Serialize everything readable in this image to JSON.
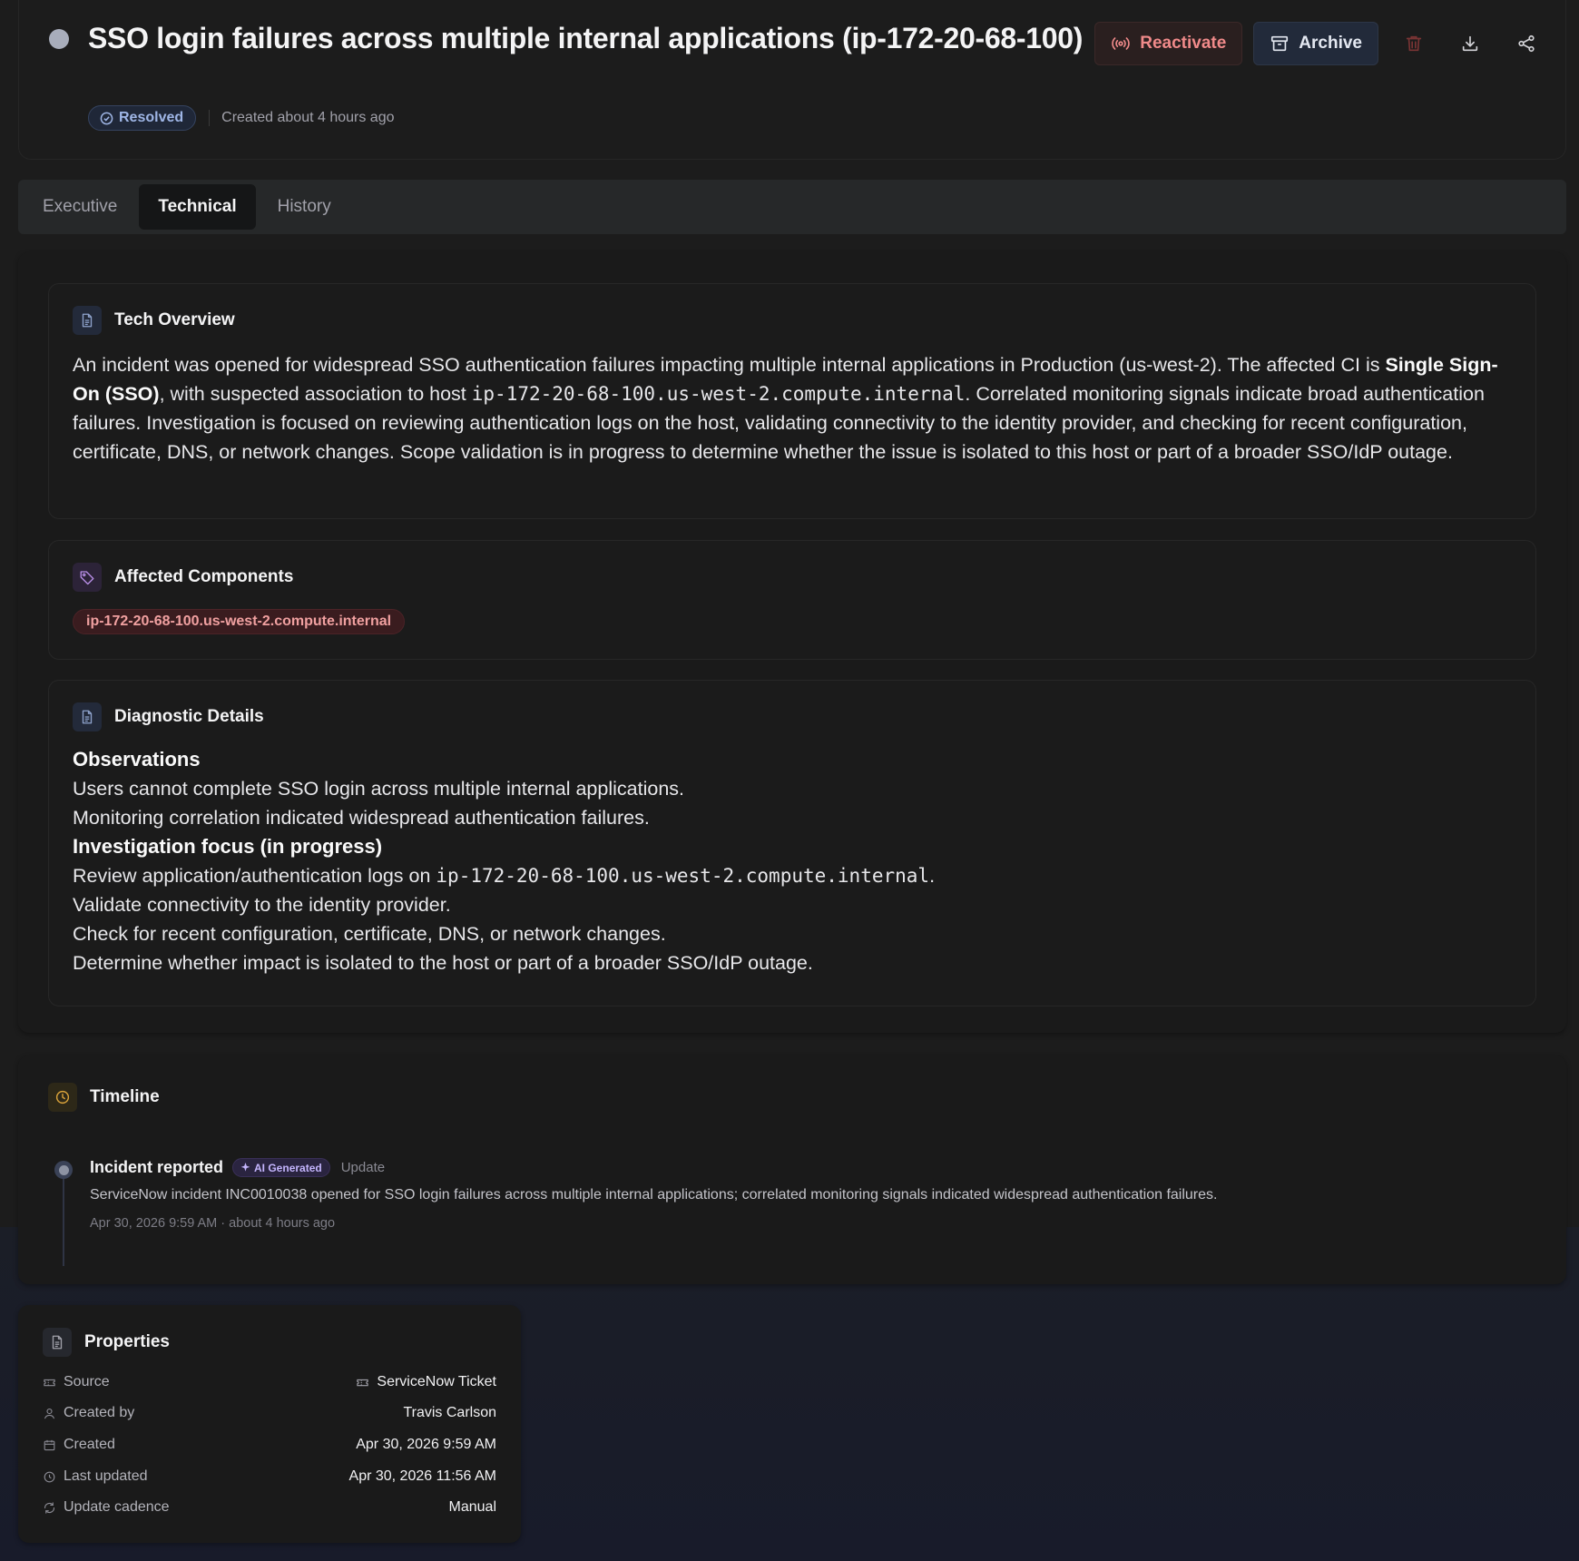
{
  "incident": {
    "title": "SSO login failures across multiple internal applications (ip-172-20-68-100)",
    "status": "Resolved",
    "created_relative": "Created about 4 hours ago"
  },
  "actions": {
    "reactivate_label": "Reactivate",
    "archive_label": "Archive",
    "delete_icon": "trash-icon",
    "download_icon": "download-icon",
    "share_icon": "share-icon"
  },
  "tabs": [
    {
      "label": "Executive",
      "active": false
    },
    {
      "label": "Technical",
      "active": true
    },
    {
      "label": "History",
      "active": false
    }
  ],
  "tech_overview": {
    "title": "Tech Overview",
    "p1": "An incident was opened for widespread SSO authentication failures impacting multiple internal applications in Production (us-west-2). The affected CI is ",
    "ci": "Single Sign-On (SSO)",
    "p2": ", with suspected association to host ",
    "host": "ip-172-20-68-100.us-west-2.compute.internal",
    "p3": ". Correlated monitoring signals indicate broad authentication failures. Investigation is focused on reviewing authentication logs on the host, validating connectivity to the identity provider, and checking for recent configuration, certificate, DNS, or network changes. Scope validation is in progress to determine whether the issue is isolated to this host or part of a broader SSO/IdP outage."
  },
  "affected_components": {
    "title": "Affected Components",
    "items": [
      "ip-172-20-68-100.us-west-2.compute.internal"
    ]
  },
  "diagnostic_details": {
    "title": "Diagnostic Details",
    "observations_heading": "Observations",
    "obs1": "Users cannot complete SSO login across multiple internal applications.",
    "obs2": "Monitoring correlation indicated widespread authentication failures.",
    "investigation_heading": "Investigation focus (in progress)",
    "inv1_a": "Review application/authentication logs on ",
    "inv1_host": "ip-172-20-68-100.us-west-2.compute.internal",
    "inv1_b": ".",
    "inv2": "Validate connectivity to the identity provider.",
    "inv3": "Check for recent configuration, certificate, DNS, or network changes.",
    "inv4": "Determine whether impact is isolated to the host or part of a broader SSO/IdP outage."
  },
  "timeline": {
    "title": "Timeline",
    "events": [
      {
        "event": "Incident reported",
        "badge": "AI Generated",
        "type": "Update",
        "description": "ServiceNow incident INC0010038 opened for SSO login failures across multiple internal applications; correlated monitoring signals indicated widespread authentication failures.",
        "timestamp": "Apr 30, 2026 9:59 AM",
        "relative": "about 4 hours ago"
      }
    ]
  },
  "properties": {
    "title": "Properties",
    "rows": [
      {
        "key": "Source",
        "value": "ServiceNow Ticket"
      },
      {
        "key": "Created by",
        "value": "Travis Carlson"
      },
      {
        "key": "Created",
        "value": "Apr 30, 2026 9:59 AM"
      },
      {
        "key": "Last updated",
        "value": "Apr 30, 2026 11:56 AM"
      },
      {
        "key": "Update cadence",
        "value": "Manual"
      }
    ]
  },
  "colors": {
    "accent_resolved": "#9fb6e6",
    "danger": "#f08a8a",
    "ai_badge": "#c4b5fd"
  }
}
